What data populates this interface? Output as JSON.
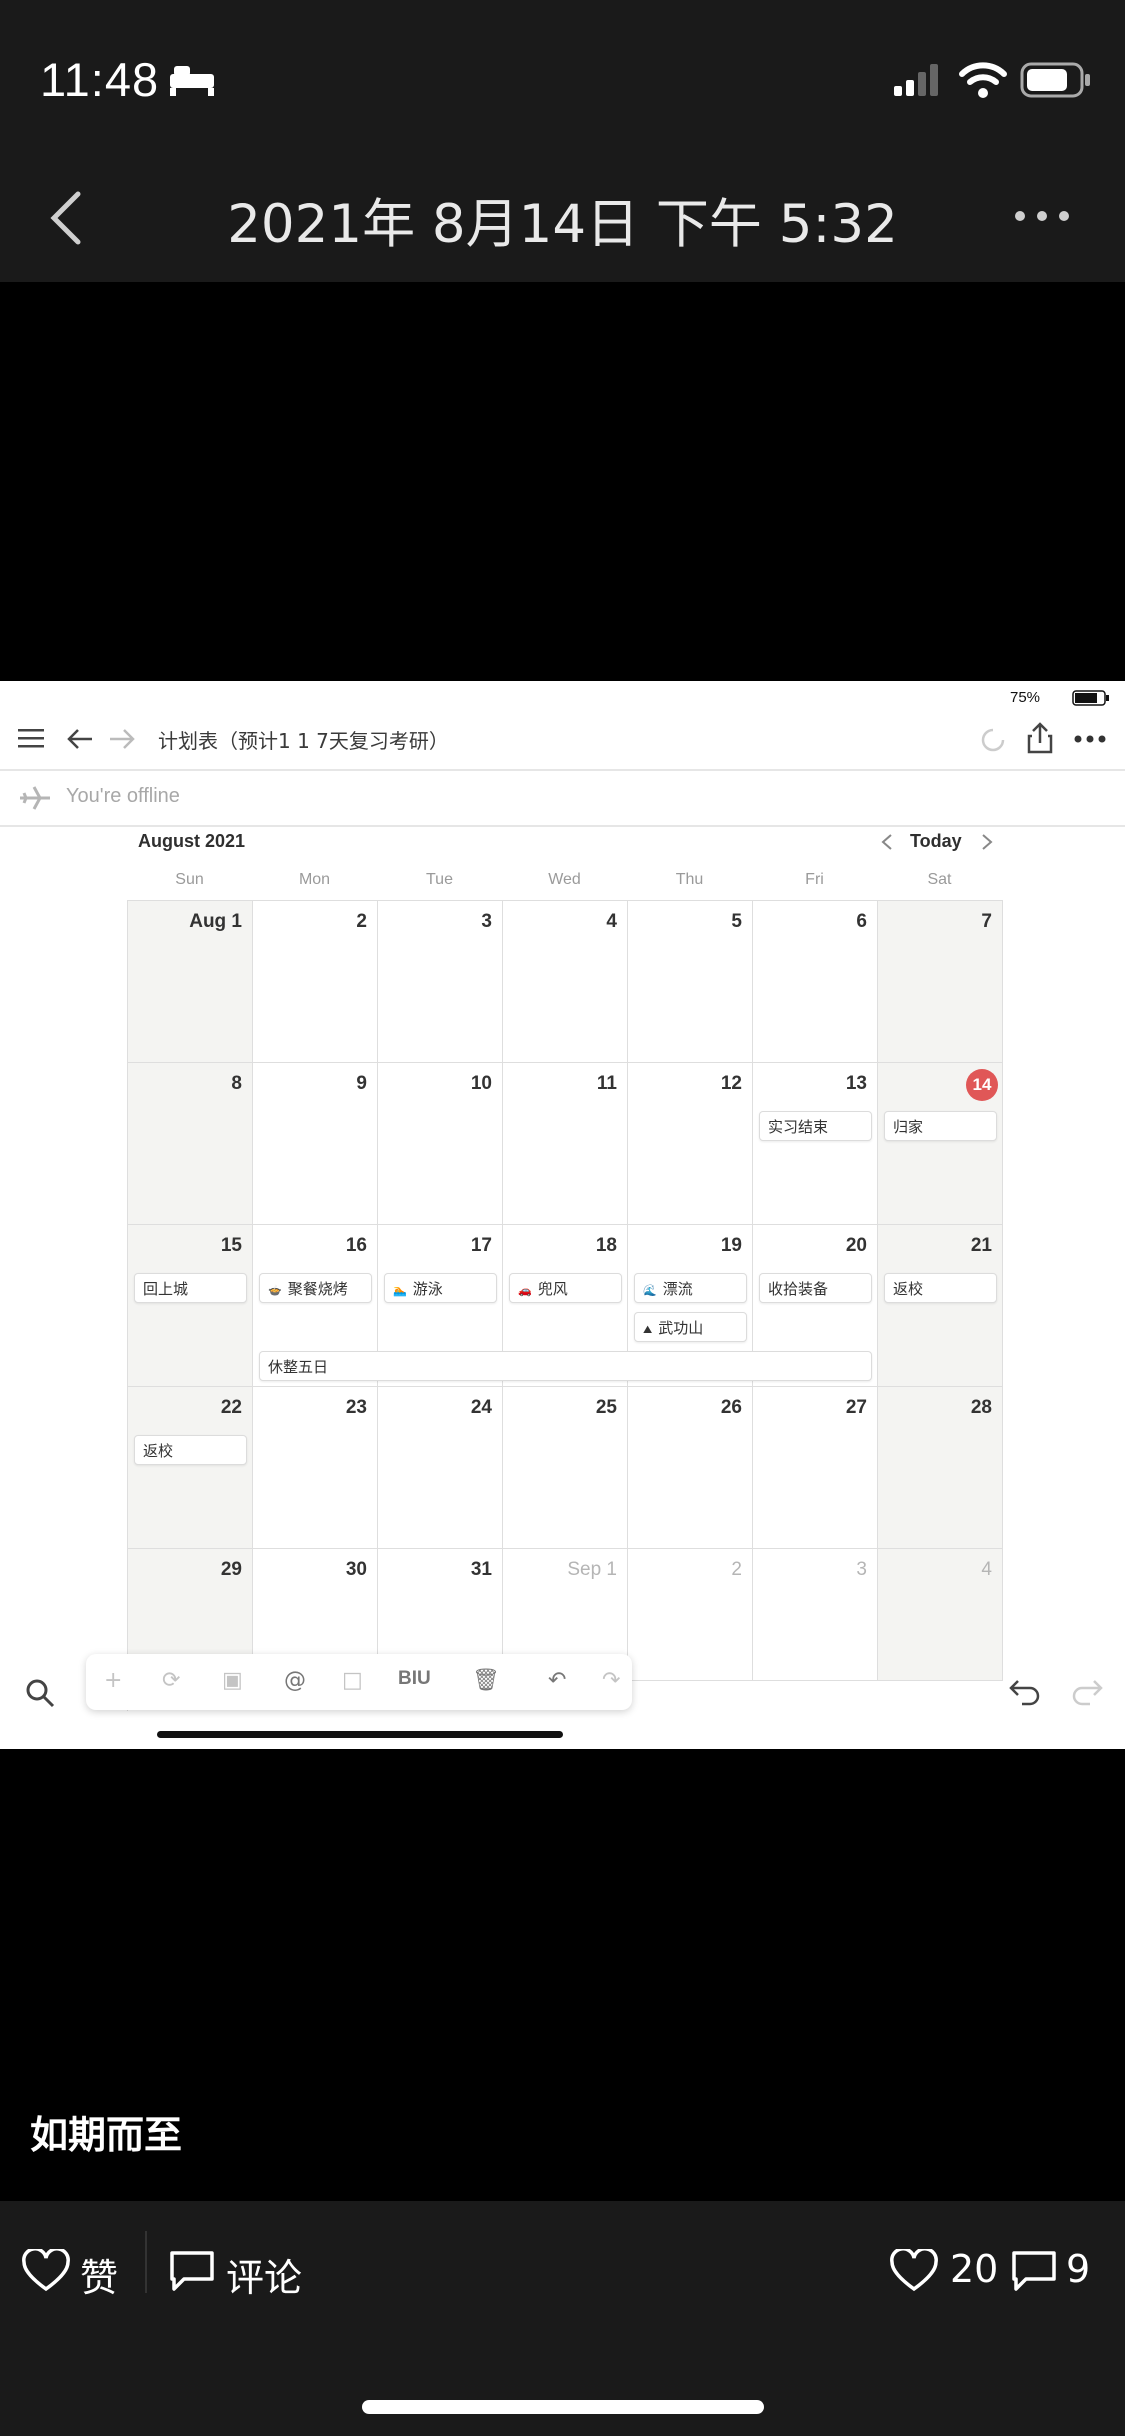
{
  "status_bar": {
    "time": "11:48"
  },
  "header": {
    "title": "2021年 8月14日 下午 5:32"
  },
  "screenshot": {
    "battery_percent": "75%",
    "page_title": "计划表（预计1 1 7天复习考研）",
    "offline_text": "You're offline",
    "month_label": "August 2021",
    "today_button": "Today",
    "weekdays": [
      "Sun",
      "Mon",
      "Tue",
      "Wed",
      "Thu",
      "Fri",
      "Sat"
    ],
    "days": [
      [
        "Aug 1",
        "2",
        "3",
        "4",
        "5",
        "6",
        "7"
      ],
      [
        "8",
        "9",
        "10",
        "11",
        "12",
        "13",
        "14"
      ],
      [
        "15",
        "16",
        "17",
        "18",
        "19",
        "20",
        "21"
      ],
      [
        "22",
        "23",
        "24",
        "25",
        "26",
        "27",
        "28"
      ],
      [
        "29",
        "30",
        "31",
        "Sep 1",
        "2",
        "3",
        "4"
      ]
    ],
    "events": {
      "e1": "实习结束",
      "e2": "归家",
      "e3": "回上城",
      "e4": "聚餐烧烤",
      "e5": "游泳",
      "e6": "兜风",
      "e7": "漂流",
      "e8": "武功山",
      "e9": "收拾装备",
      "e10": "返校",
      "e11": "休整五日",
      "e12": "返校"
    },
    "format_label": "BIU"
  },
  "caption": "如期而至",
  "actions": {
    "like_label": "赞",
    "comment_label": "评论",
    "like_count": "20",
    "comment_count": "9"
  },
  "colors": {
    "today_badge": "#e05757",
    "weekend_bg": "#f4f4f2"
  }
}
